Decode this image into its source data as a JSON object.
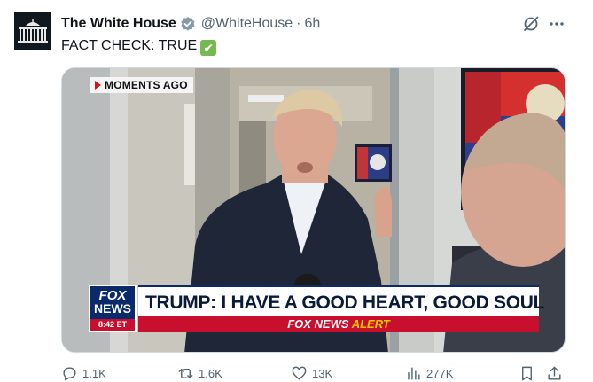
{
  "tweet": {
    "display_name": "The White House",
    "handle": "@WhiteHouse",
    "separator": "·",
    "time": "6h",
    "text": "FACT CHECK: TRUE",
    "emoji": "✔"
  },
  "icons": {
    "avatar": "white-house-logo",
    "badge": "gray-government-verified-badge",
    "grok": "grok-icon",
    "more": "more-dots-icon",
    "reply": "reply-icon",
    "retweet": "retweet-icon",
    "like": "heart-icon",
    "views": "views-bar-chart-icon",
    "bookmark": "bookmark-icon",
    "share": "share-icon"
  },
  "media": {
    "badge_text": "MOMENTS AGO",
    "logo_line1": "FOX",
    "logo_line2": "NEWS",
    "logo_time": "8:42 ET",
    "headline": "TRUMP: I HAVE A GOOD HEART, GOOD SOUL",
    "alert_brand": "FOX NEWS",
    "alert_word": "ALERT"
  },
  "actions": {
    "replies": "1.1K",
    "reposts": "1.6K",
    "likes": "13K",
    "views": "277K"
  },
  "colors": {
    "text_primary": "#0f1419",
    "text_secondary": "#536471",
    "fox_blue": "#0a2a6a",
    "fox_red": "#c8102e",
    "alert_yellow": "#ffcc00",
    "check_green": "#76b852"
  }
}
